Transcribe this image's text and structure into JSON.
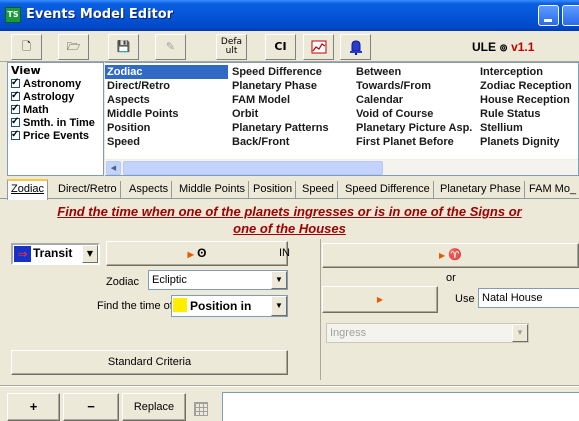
{
  "window": {
    "title": "Events Model Editor",
    "app_icon": "TS"
  },
  "toolbar": {
    "buttons": [
      {
        "name": "new-file-icon",
        "glyph": "🗋"
      },
      {
        "name": "open-folder-icon",
        "glyph": "🗁"
      },
      {
        "name": "save-icon",
        "glyph": "💾"
      },
      {
        "name": "edit-icon",
        "glyph": "✎"
      }
    ],
    "default_label_top": "Defa",
    "default_label_bottom": "ult",
    "ci_label": "CI",
    "chart_icon": "chart-icon",
    "bell_icon": "bell-icon",
    "ule_label": "ULE",
    "ule_symbol": "⊚",
    "version": "v1.1"
  },
  "view": {
    "header": "View",
    "items": [
      "Astronomy",
      "Astrology",
      "Math",
      "Smth. in Time",
      "Price Events"
    ]
  },
  "feature_grid": {
    "col1": [
      "Zodiac",
      "Direct/Retro",
      "Aspects",
      "Middle Points",
      "Position",
      "Speed"
    ],
    "col2": [
      "Speed Difference",
      "Planetary Phase",
      "FAM Model",
      "Orbit",
      "Planetary Patterns",
      "Back/Front"
    ],
    "col3": [
      "Between",
      "Towards/From",
      "Calendar",
      "Void of Course",
      "Planetary Picture Asp.",
      "First Planet Before"
    ],
    "col4": [
      "Interception",
      "Zodiac Reception",
      "House Reception",
      "Rule Status",
      "Stellium",
      "Planets Dignity"
    ],
    "selected": "Zodiac"
  },
  "tabs": [
    "Zodiac",
    "Direct/Retro",
    "Aspects",
    "Middle Points",
    "Position",
    "Speed",
    "Speed Difference",
    "Planetary Phase",
    "FAM Mo_"
  ],
  "description_line1": "Find the time when one of the planets ingresses or is in one of the Signs or",
  "description_line2": "one of the Houses",
  "form": {
    "transit_value": "Transit",
    "planet_button_symbol": "ʘ",
    "in_label": "IN",
    "sign_button_symbol": "♈",
    "zodiac_label": "Zodiac",
    "zodiac_value": "Ecliptic",
    "or_label": "or",
    "find_time_label": "Find the time of",
    "find_time_value": "Position in",
    "use_label": "Use",
    "use_value": "Natal House",
    "ingress_value": "Ingress",
    "standard_criteria_label": "Standard Criteria"
  },
  "bottom": {
    "add_symbol": "+",
    "remove_symbol": "−",
    "replace_label": "Replace"
  },
  "colors": {
    "title_bar": "#0554d8",
    "accent_red": "#a00000",
    "selection": "#316ac5",
    "swatch_yellow": "#ffee00"
  }
}
